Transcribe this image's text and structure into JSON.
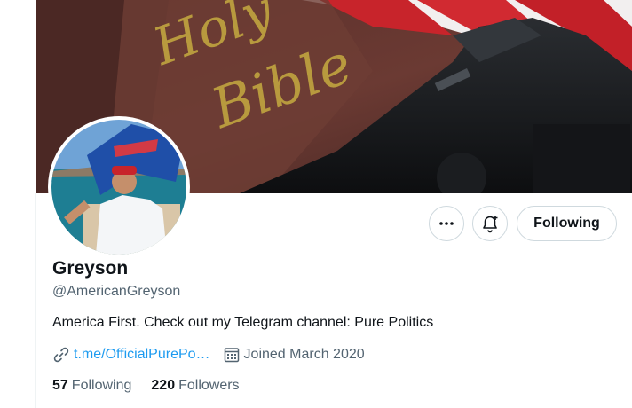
{
  "profile": {
    "display_name": "Greyson",
    "handle": "@AmericanGreyson",
    "bio": "America First. Check out my Telegram channel: Pure Politics",
    "link": "t.me/OfficialPurePo…",
    "joined": "Joined March 2020"
  },
  "stats": {
    "following_count": "57",
    "following_label": "Following",
    "followers_count": "220",
    "followers_label": "Followers"
  },
  "actions": {
    "follow_label": "Following",
    "more_icon": "more-dots-icon",
    "notify_icon": "bell-plus-icon"
  },
  "banner": {
    "book_text_1": "Holy",
    "book_text_2": "Bible"
  },
  "colors": {
    "link": "#1d9bf0",
    "secondary_text": "#536471",
    "border": "#cfd9de"
  }
}
